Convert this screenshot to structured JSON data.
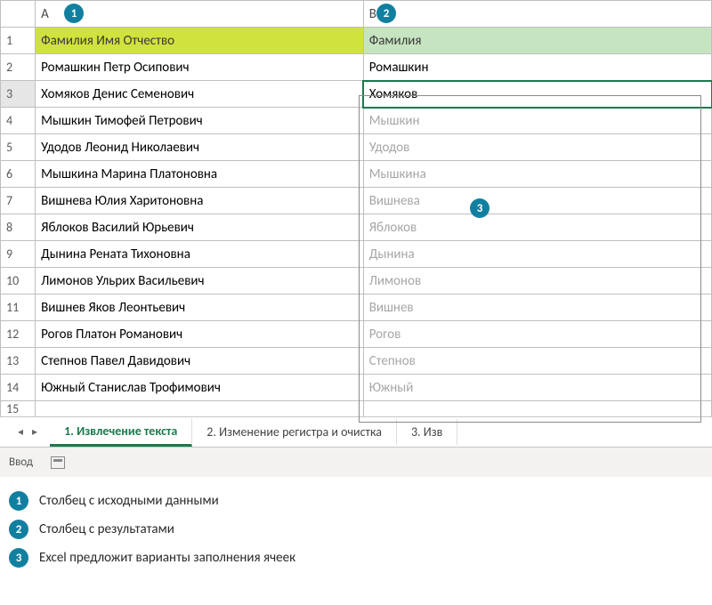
{
  "columns": {
    "a": "A",
    "b": "B"
  },
  "headers": {
    "a": "Фамилия Имя Отчество",
    "b": "Фамилия"
  },
  "rows": [
    {
      "n": "1"
    },
    {
      "n": "2",
      "a": "Ромашкин Петр Осипович",
      "b": "Ромашкин",
      "suggest": false
    },
    {
      "n": "3",
      "a": "Хомяков Денис Семенович",
      "b": "Хомяков",
      "suggest": false,
      "active": true
    },
    {
      "n": "4",
      "a": "Мышкин Тимофей Петрович",
      "b": "Мышкин",
      "suggest": true
    },
    {
      "n": "5",
      "a": "Удодов Леонид Николаевич",
      "b": "Удодов",
      "suggest": true
    },
    {
      "n": "6",
      "a": "Мышкина Марина Платоновна",
      "b": "Мышкина",
      "suggest": true
    },
    {
      "n": "7",
      "a": "Вишнева Юлия Харитоновна",
      "b": "Вишнева",
      "suggest": true
    },
    {
      "n": "8",
      "a": "Яблоков Василий Юрьевич",
      "b": "Яблоков",
      "suggest": true
    },
    {
      "n": "9",
      "a": "Дынина Рената Тихоновна",
      "b": "Дынина",
      "suggest": true
    },
    {
      "n": "10",
      "a": "Лимонов Ульрих Васильевич",
      "b": "Лимонов",
      "suggest": true
    },
    {
      "n": "11",
      "a": "Вишнев Яков Леонтьевич",
      "b": "Вишнев",
      "suggest": true
    },
    {
      "n": "12",
      "a": "Рогов Платон Романович",
      "b": "Рогов",
      "suggest": true
    },
    {
      "n": "13",
      "a": "Степнов Павел Давидович",
      "b": "Степнов",
      "suggest": true
    },
    {
      "n": "14",
      "a": "Южный Станислав Трофимович",
      "b": "Южный",
      "suggest": true
    },
    {
      "n": "15"
    }
  ],
  "tabs": {
    "nav_prev": "◂",
    "nav_next": "▸",
    "items": [
      {
        "label": "1. Извлечение текста",
        "active": true
      },
      {
        "label": "2. Изменение регистра и очистка",
        "active": false
      },
      {
        "label": "3. Изв",
        "active": false
      }
    ]
  },
  "status": {
    "mode": "Ввод"
  },
  "legend": [
    {
      "num": "1",
      "text": "Столбец с исходными данными"
    },
    {
      "num": "2",
      "text": "Столбец с результатами"
    },
    {
      "num": "3",
      "text": "Excel предложит варианты заполнения ячеек"
    }
  ],
  "callouts": {
    "c1": "1",
    "c2": "2",
    "c3": "3"
  }
}
